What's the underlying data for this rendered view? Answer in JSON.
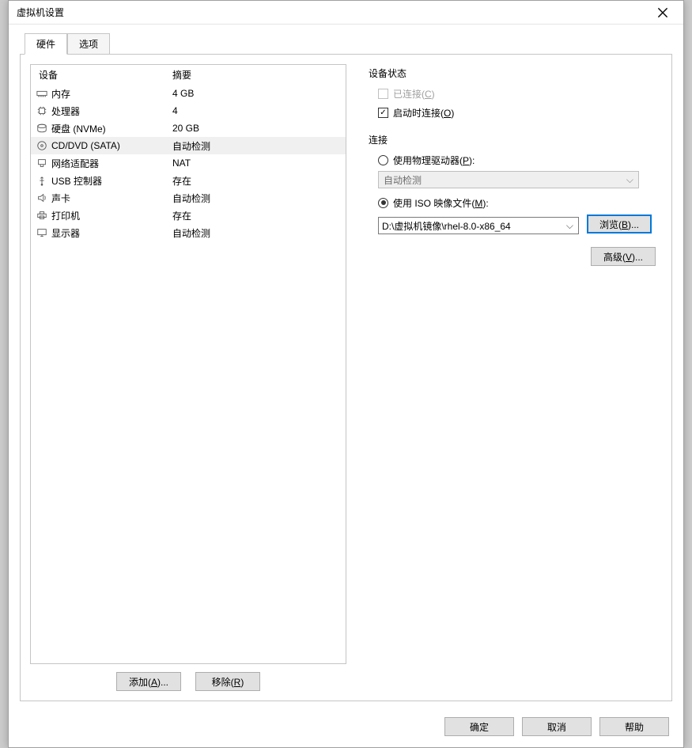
{
  "window": {
    "title": "虚拟机设置"
  },
  "tabs": {
    "hardware": "硬件",
    "options": "选项",
    "active": "hardware"
  },
  "table": {
    "headers": {
      "device": "设备",
      "summary": "摘要"
    },
    "rows": [
      {
        "icon": "memory-icon",
        "name": "内存",
        "summary": "4 GB",
        "selected": false
      },
      {
        "icon": "cpu-icon",
        "name": "处理器",
        "summary": "4",
        "selected": false
      },
      {
        "icon": "disk-icon",
        "name": "硬盘 (NVMe)",
        "summary": "20 GB",
        "selected": false
      },
      {
        "icon": "cd-icon",
        "name": "CD/DVD (SATA)",
        "summary": "自动检测",
        "selected": true
      },
      {
        "icon": "network-icon",
        "name": "网络适配器",
        "summary": "NAT",
        "selected": false
      },
      {
        "icon": "usb-icon",
        "name": "USB 控制器",
        "summary": "存在",
        "selected": false
      },
      {
        "icon": "sound-icon",
        "name": "声卡",
        "summary": "自动检测",
        "selected": false
      },
      {
        "icon": "printer-icon",
        "name": "打印机",
        "summary": "存在",
        "selected": false
      },
      {
        "icon": "display-icon",
        "name": "显示器",
        "summary": "自动检测",
        "selected": false
      }
    ]
  },
  "buttons": {
    "add_pre": "添加(",
    "add_hot": "A",
    "add_post": ")...",
    "remove_pre": "移除(",
    "remove_hot": "R",
    "remove_post": ")",
    "browse_pre": "浏览(",
    "browse_hot": "B",
    "browse_post": ")...",
    "advanced_pre": "高级(",
    "advanced_hot": "V",
    "advanced_post": ")...",
    "ok": "确定",
    "cancel": "取消",
    "help": "帮助"
  },
  "device_state": {
    "title": "设备状态",
    "connected_pre": "已连接(",
    "connected_hot": "C",
    "connected_post": ")",
    "connect_on_pre": "启动时连接(",
    "connect_on_hot": "O",
    "connect_on_post": ")",
    "connected_checked": false,
    "connect_on_checked": true
  },
  "connection": {
    "title": "连接",
    "use_physical_pre": "使用物理驱动器(",
    "use_physical_hot": "P",
    "use_physical_post": "):",
    "physical_value": "自动检测",
    "use_iso_pre": "使用 ISO 映像文件(",
    "use_iso_hot": "M",
    "use_iso_post": "):",
    "iso_value": "D:\\虚拟机镜像\\rhel-8.0-x86_64",
    "selected": "iso"
  }
}
